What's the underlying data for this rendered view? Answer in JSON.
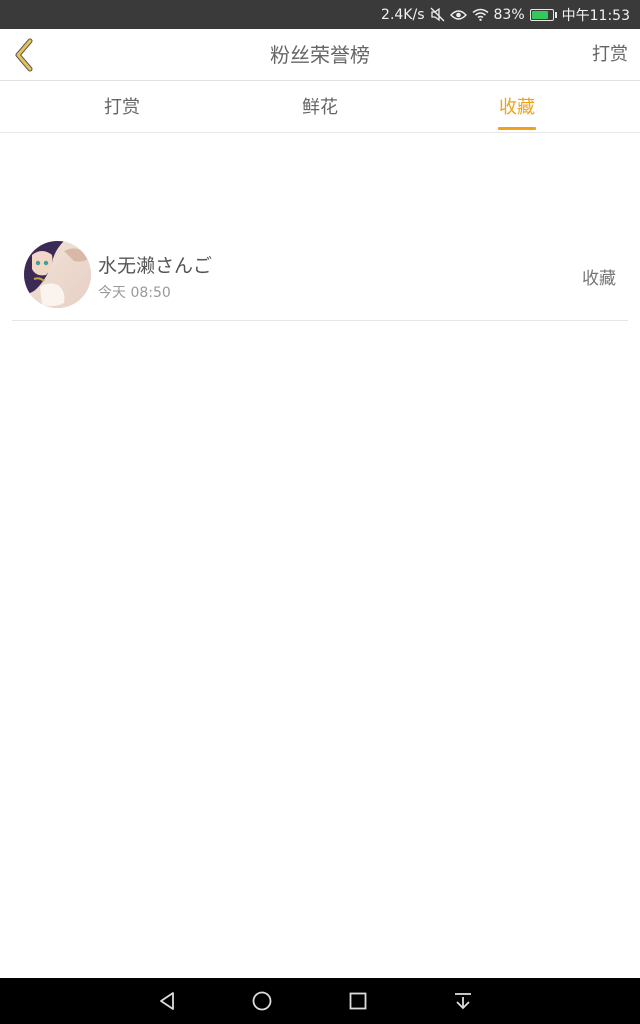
{
  "status_bar": {
    "net_speed": "2.4K/s",
    "battery_percent": "83%",
    "battery_level": 0.83,
    "time": "中午11:53",
    "icons": [
      "mute-icon",
      "eye-icon",
      "wifi-icon",
      "battery-icon"
    ]
  },
  "header": {
    "title": "粉丝荣誉榜",
    "action_label": "打赏",
    "back_icon": "chevron-left-icon"
  },
  "tabs": [
    {
      "label": "打赏",
      "active": false
    },
    {
      "label": "鲜花",
      "active": false
    },
    {
      "label": "收藏",
      "active": true
    }
  ],
  "colors": {
    "accent": "#f0a21c",
    "back_icon": "#e6c15a",
    "status_bar_bg": "#3a3a3a",
    "nav_bar_bg": "#000000"
  },
  "fans": [
    {
      "name": "水无濑さんご",
      "time": "今天 08:50",
      "action": "收藏"
    }
  ],
  "nav_bar": {
    "icons": [
      "nav-back-icon",
      "nav-home-icon",
      "nav-recent-icon",
      "nav-down-icon"
    ]
  }
}
